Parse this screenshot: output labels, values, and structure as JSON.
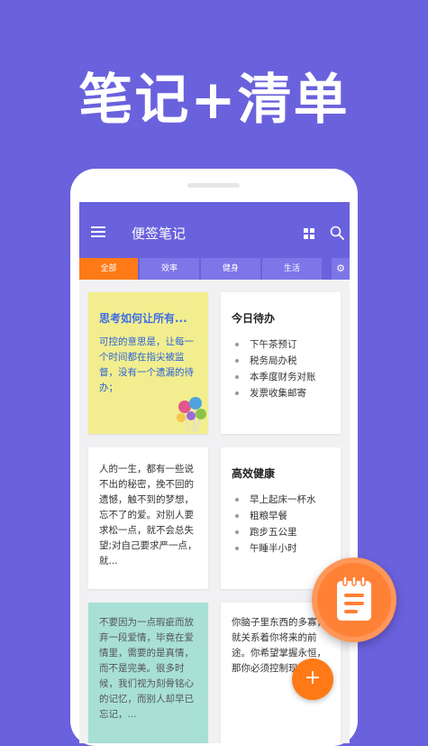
{
  "headline": "笔记+清单",
  "app": {
    "title": "便签笔记"
  },
  "tabs": [
    "全部",
    "效率",
    "健身",
    "生活"
  ],
  "colors": {
    "background": "#6a61dd",
    "accent": "#ff7a16",
    "yellow_card": "#f2ee8f",
    "teal_card": "#a8e0d6"
  },
  "icons": [
    "menu-icon",
    "grid-view-icon",
    "search-icon",
    "settings-icon",
    "add-icon",
    "notebook-icon"
  ],
  "notes": {
    "n1": {
      "title": "思考如何让所有...",
      "body": "可控的意思是，让每一个时间都在指尖被监督，没有一个遗漏的待办；"
    },
    "n2": {
      "title": "今日待办",
      "items": [
        "下午茶预订",
        "税务局办税",
        "本季度财务对账",
        "发票收集邮寄"
      ]
    },
    "n3": {
      "body": "人的一生，都有一些说不出的秘密，挽不回的遗憾，触不到的梦想，忘不了的爱。对别人要求松一点，就不会总失望;对自己要求严一点，就..."
    },
    "n4": {
      "title": "高效健康",
      "items": [
        "早上起床一杯水",
        "粗粮早餐",
        "跑步五公里",
        "午睡半小时"
      ]
    },
    "n5": {
      "body": "不要因为一点瑕疵而放弃一段爱情，毕竟在爱情里，需要的是真情，而不是完美。很多时候，我们视为刻骨铭心的记忆，而别人却早已忘记，..."
    },
    "n6": {
      "body": "你脑子里东西的多寡，就关系着你将来的前途。你希望掌握永恒，那你必须控制现在。"
    }
  },
  "fab": {
    "label": "+"
  }
}
